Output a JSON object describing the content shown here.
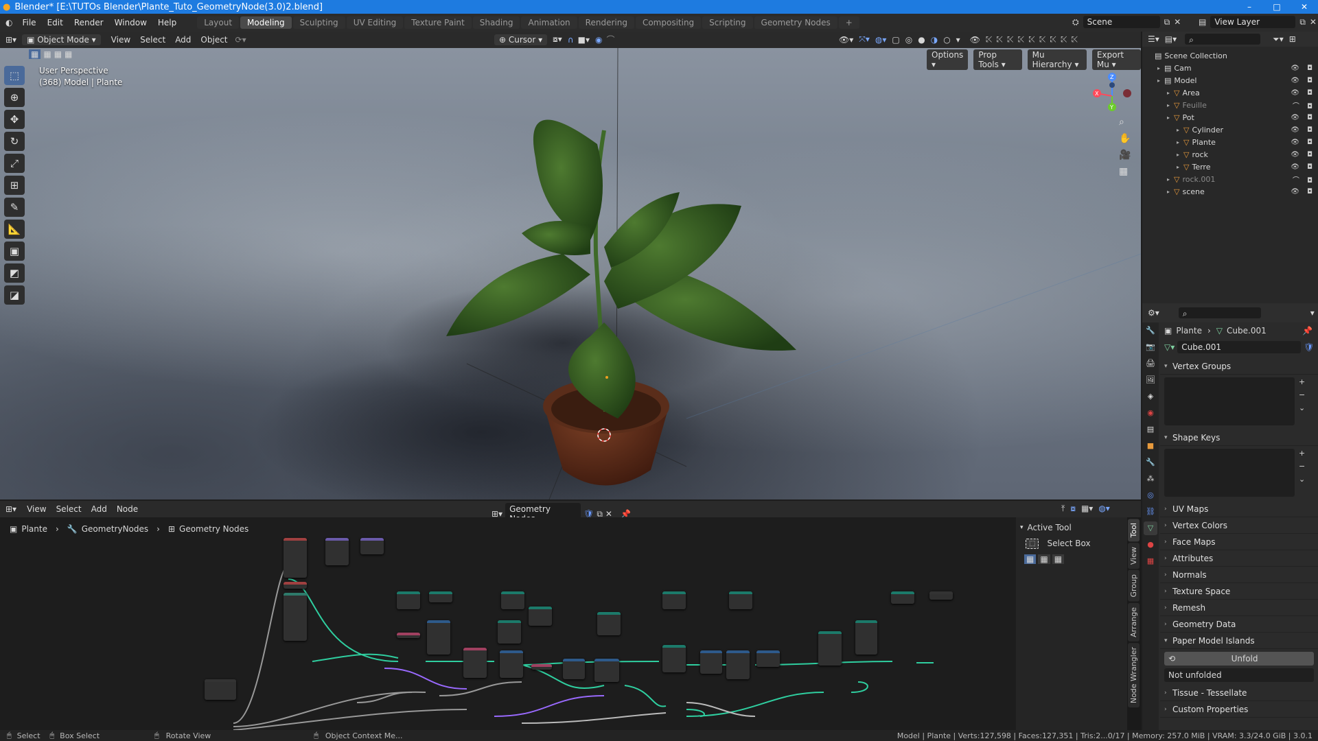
{
  "window": {
    "title": "Blender* [E:\\TUTOs Blender\\Plante_Tuto_GeometryNode(3.0)2.blend]",
    "min": "–",
    "max": "□",
    "close": "✕"
  },
  "menu": [
    "File",
    "Edit",
    "Render",
    "Window",
    "Help"
  ],
  "workspaces": [
    "Layout",
    "Modeling",
    "Sculpting",
    "UV Editing",
    "Texture Paint",
    "Shading",
    "Animation",
    "Rendering",
    "Compositing",
    "Scripting",
    "Geometry Nodes",
    "+"
  ],
  "active_workspace": "Modeling",
  "scene": "Scene",
  "view_layer": "View Layer",
  "viewport": {
    "mode": "Object Mode",
    "menus": [
      "View",
      "Select",
      "Add",
      "Object"
    ],
    "pivot": "Cursor",
    "header2": [
      "Options",
      "Prop Tools",
      "Mu Hierarchy",
      "Export Mu"
    ],
    "info_line1": "User Perspective",
    "info_line2": "(368) Model | Plante",
    "gizmo": {
      "x": "X",
      "y": "Y",
      "z": "Z"
    }
  },
  "outliner": {
    "search_placeholder": "",
    "rows": [
      {
        "name": "Scene Collection",
        "indent": 0,
        "state": "normal"
      },
      {
        "name": "Cam",
        "indent": 1,
        "state": "normal"
      },
      {
        "name": "Model",
        "indent": 1,
        "state": "normal"
      },
      {
        "name": "Area",
        "indent": 2,
        "state": "normal"
      },
      {
        "name": "Feuille",
        "indent": 2,
        "state": "dim"
      },
      {
        "name": "Pot",
        "indent": 2,
        "state": "normal"
      },
      {
        "name": "Cylinder",
        "indent": 3,
        "state": "normal"
      },
      {
        "name": "Plante",
        "indent": 3,
        "state": "normal"
      },
      {
        "name": "rock",
        "indent": 3,
        "state": "normal"
      },
      {
        "name": "Terre",
        "indent": 3,
        "state": "normal"
      },
      {
        "name": "rock.001",
        "indent": 2,
        "state": "dim"
      },
      {
        "name": "scene",
        "indent": 2,
        "state": "normal"
      }
    ]
  },
  "properties": {
    "breadcrumb_object": "Plante",
    "breadcrumb_data": "Cube.001",
    "datablock": "Cube.001",
    "sections": [
      "Vertex Groups",
      "Shape Keys",
      "UV Maps",
      "Vertex Colors",
      "Face Maps",
      "Attributes",
      "Normals",
      "Texture Space",
      "Remesh",
      "Geometry Data",
      "Paper Model Islands"
    ],
    "unfold_button": "Unfold",
    "not_unfolded": "Not unfolded",
    "sections_after": [
      "Tissue - Tessellate",
      "Custom Properties"
    ]
  },
  "node_editor": {
    "menus": [
      "View",
      "Select",
      "Add",
      "Node"
    ],
    "tree_name": "Geometry Nodes",
    "breadcrumb": [
      "Plante",
      "GeometryNodes",
      "Geometry Nodes"
    ],
    "active_tool_title": "Active Tool",
    "active_tool_name": "Select Box",
    "side_tabs": [
      "Tool",
      "View",
      "Group",
      "Arrange",
      "Node Wrangler"
    ]
  },
  "statusbar": {
    "select": "Select",
    "box_select": "Box Select",
    "rotate": "Rotate View",
    "context": "Object Context Me...",
    "stats": "Model | Plante | Verts:127,598 | Faces:127,351 | Tris:2...0/17 | Memory: 257.0 MiB | VRAM: 3.3/24.0 GiB | 3.0.1"
  },
  "colors": {
    "accent": "#1e7be0",
    "node_link": "#2fcfa0",
    "geometry_header": "#1c7a6a",
    "selected": "#334d80"
  }
}
